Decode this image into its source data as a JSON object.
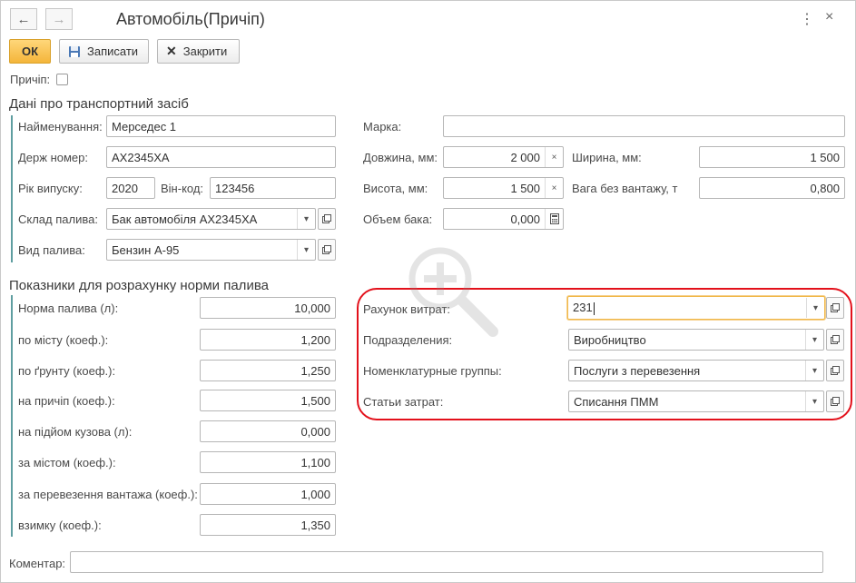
{
  "window": {
    "title": "Автомобіль(Причіп)"
  },
  "toolbar": {
    "ok_label": "ОК",
    "save_label": "Записати",
    "close_label": "Закрити"
  },
  "trailer": {
    "label": "Причіп:",
    "checked": false
  },
  "vehicle_section": {
    "title": "Дані про транспортний засіб",
    "name_label": "Найменування:",
    "name_value": "Мерседес 1",
    "plate_label": "Держ номер:",
    "plate_value": "АХ2345ХА",
    "year_label": "Рік випуску:",
    "year_value": "2020",
    "vin_label": "Він-код:",
    "vin_value": "123456",
    "fuel_storage_label": "Склад палива:",
    "fuel_storage_value": "Бак автомобіля АХ2345ХА",
    "fuel_type_label": "Вид палива:",
    "fuel_type_value": "Бензин А-95",
    "brand_label": "Марка:",
    "brand_value": "",
    "length_label": "Довжина, мм:",
    "length_value": "2 000",
    "width_label": "Ширина, мм:",
    "width_value": "1 500",
    "height_label": "Висота, мм:",
    "height_value": "1 500",
    "weight_label": "Вага без вантажу, т",
    "weight_value": "0,800",
    "tank_label": "Объем бака:",
    "tank_value": "0,000"
  },
  "norms_section": {
    "title": "Показники для розрахунку норми палива",
    "rows": [
      {
        "label": "Норма палива (л):",
        "value": "10,000"
      },
      {
        "label": "по місту (коеф.):",
        "value": "1,200"
      },
      {
        "label": "по ґрунту (коеф.):",
        "value": "1,250"
      },
      {
        "label": "на причіп (коеф.):",
        "value": "1,500"
      },
      {
        "label": "на підйом кузова (л):",
        "value": "0,000"
      },
      {
        "label": "за містом (коеф.):",
        "value": "1,100"
      },
      {
        "label": "за перевезення вантажа (коеф.):",
        "value": "1,000"
      },
      {
        "label": "взимку (коеф.):",
        "value": "1,350"
      }
    ]
  },
  "accounting": {
    "account_label": "Рахунок витрат:",
    "account_value": "231",
    "division_label": "Подразделения:",
    "division_value": "Виробництво",
    "nomenclature_label": "Номенклатурные группы:",
    "nomenclature_value": "Послуги з перевезення",
    "cost_item_label": "Статьи затрат:",
    "cost_item_value": "Списання ПММ"
  },
  "comment": {
    "label": "Коментар:",
    "value": ""
  },
  "icons": [
    "back-arrow-icon",
    "forward-arrow-icon",
    "more-icon",
    "close-icon",
    "save-icon",
    "close-x-icon",
    "dropdown-arrow-icon",
    "open-icon",
    "clear-icon",
    "calculator-icon",
    "zoom-plus-icon"
  ],
  "colors": {
    "ok_button": "#f4b53a",
    "highlight": "#e3111b",
    "section_bar": "#5f9ea0",
    "focus_border": "#f0b84a"
  }
}
